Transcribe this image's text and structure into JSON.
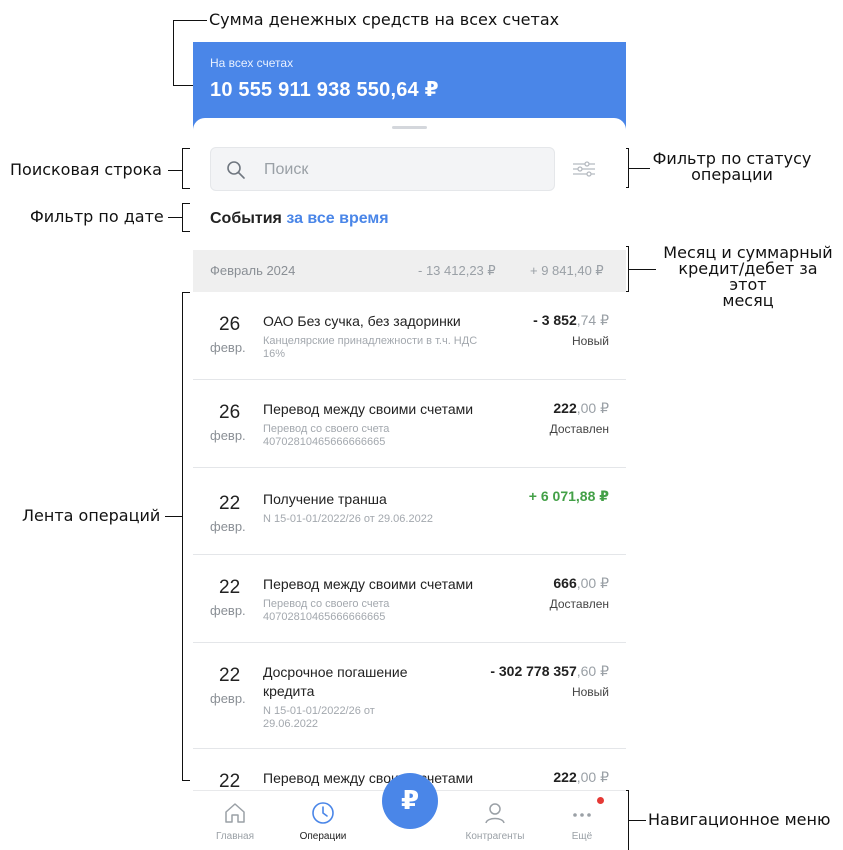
{
  "annotations": {
    "total_sum": "Сумма денежных средств на всех счетах",
    "search_bar": "Поисковая строка",
    "status_filter_line1": "Фильтр по статусу",
    "status_filter_line2": "операции",
    "date_filter": "Фильтр по дате",
    "month_summary_line1": "Месяц и суммарный",
    "month_summary_line2": "кредит/дебет за этот",
    "month_summary_line3": "месяц",
    "feed": "Лента операций",
    "nav_menu": "Навигационное меню"
  },
  "header": {
    "label": "На всех счетах",
    "amount": "10 555 911 938 550,64 ₽"
  },
  "search": {
    "placeholder": "Поиск"
  },
  "events": {
    "prefix": "События",
    "period_link": "за все время"
  },
  "month": {
    "name": "Февраль 2024",
    "debit": "- 13 412,23 ₽",
    "credit": "+ 9 841,40 ₽"
  },
  "operations": [
    {
      "day": "26",
      "month": "февр.",
      "title": "ОАО Без сучка, без задоринки",
      "sub_line1": "Канцелярские принадлежности в т.ч. НДС",
      "sub_line2": "16%",
      "amount_int": "- 3 852",
      "amount_frac": ",74 ₽",
      "status": "Новый"
    },
    {
      "day": "26",
      "month": "февр.",
      "title": "Перевод между своими счетами",
      "sub_line1": "Перевод со своего счета",
      "sub_line2": "40702810465666666665",
      "amount_int": "222",
      "amount_frac": ",00 ₽",
      "status": "Доставлен"
    },
    {
      "day": "22",
      "month": "февр.",
      "title": "Получение транша",
      "sub_line1": "N 15-01-01/2022/26 от 29.06.2022",
      "amount": "+ 6 071,88 ₽"
    },
    {
      "day": "22",
      "month": "февр.",
      "title": "Перевод между своими счетами",
      "sub_line1": "Перевод со своего счета",
      "sub_line2": "40702810465666666665",
      "amount_int": "666",
      "amount_frac": ",00 ₽",
      "status": "Доставлен"
    },
    {
      "day": "22",
      "month": "февр.",
      "title_line1": "Досрочное погашение",
      "title_line2": "кредита",
      "sub_line1": "N 15-01-01/2022/26 от",
      "sub_line2": "29.06.2022",
      "amount_int": "- 302 778 357",
      "amount_frac": ",60 ₽",
      "status": "Новый"
    },
    {
      "day": "22",
      "title": "Перевод между своими счетами",
      "amount_int": "222",
      "amount_frac": ",00 ₽"
    }
  ],
  "nav": {
    "home": "Главная",
    "operations": "Операции",
    "payments_icon": "ruble-icon",
    "contractors": "Контрагенты",
    "more": "Ещё"
  },
  "colors": {
    "accent": "#4a86e8",
    "positive": "#43a047",
    "badge": "#e53935"
  }
}
